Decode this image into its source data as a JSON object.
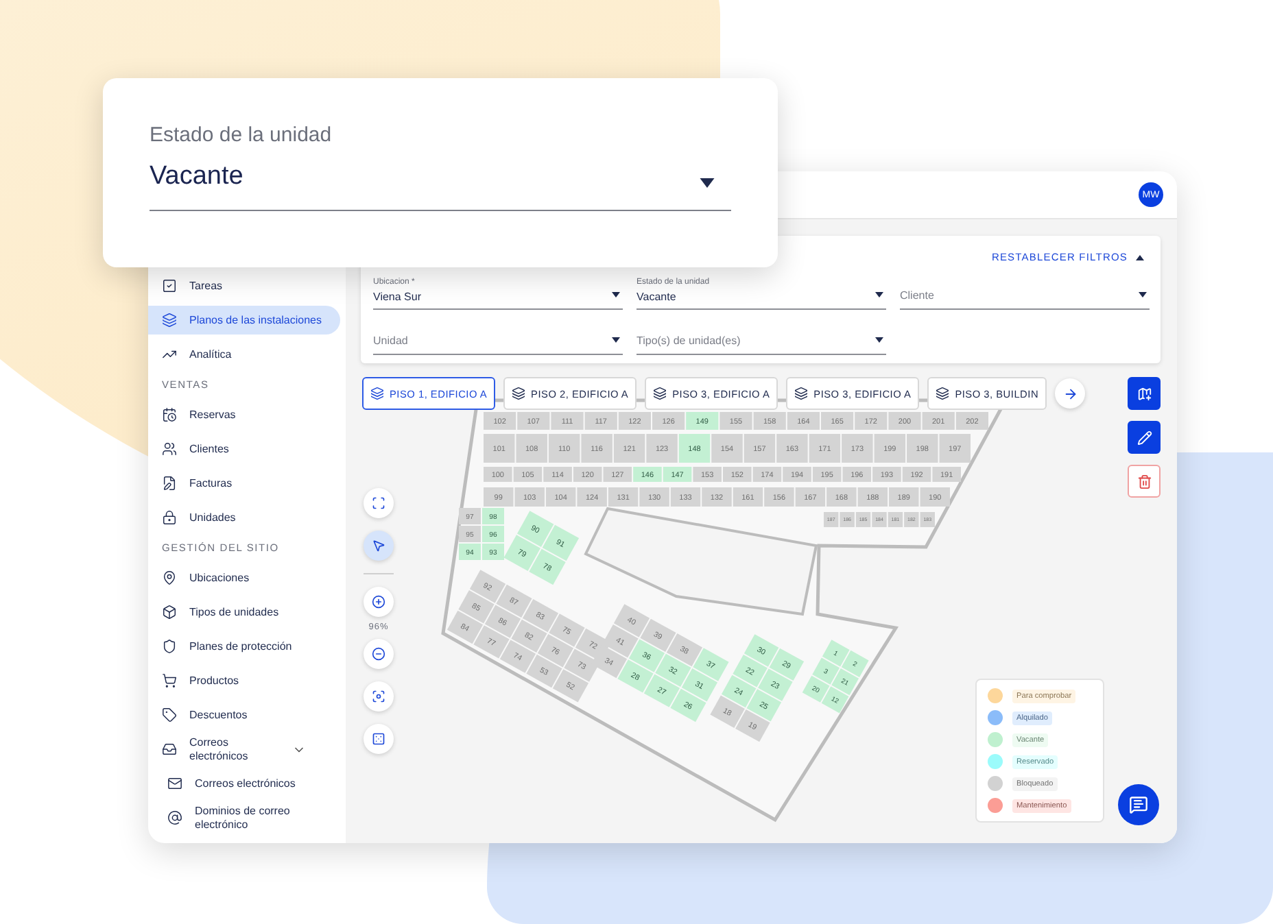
{
  "header": {
    "avatar": "MW"
  },
  "status_card": {
    "label": "Estado de la unidad",
    "value": "Vacante"
  },
  "sidebar": {
    "items": [
      {
        "kind": "item",
        "label": "Tareas",
        "selected": false
      },
      {
        "kind": "item",
        "label": "Planos de las instalaciones",
        "selected": true
      },
      {
        "kind": "item",
        "label": "Analítica",
        "selected": false
      },
      {
        "kind": "section",
        "label": "VENTAS"
      },
      {
        "kind": "item",
        "label": "Reservas",
        "selected": false
      },
      {
        "kind": "item",
        "label": "Clientes",
        "selected": false
      },
      {
        "kind": "item",
        "label": "Facturas",
        "selected": false
      },
      {
        "kind": "item",
        "label": "Unidades",
        "selected": false
      },
      {
        "kind": "section",
        "label": "GESTIÓN DEL SITIO"
      },
      {
        "kind": "item",
        "label": "Ubicaciones",
        "selected": false
      },
      {
        "kind": "item",
        "label": "Tipos de unidades",
        "selected": false
      },
      {
        "kind": "item",
        "label": "Planes de protección",
        "selected": false
      },
      {
        "kind": "item",
        "label": "Productos",
        "selected": false
      },
      {
        "kind": "item",
        "label": "Descuentos",
        "selected": false
      },
      {
        "kind": "item",
        "label": "Correos electrónicos",
        "selected": false,
        "expanded": true,
        "children": [
          {
            "label": "Correos electrónicos",
            "selected": false
          },
          {
            "label": "Dominios de correo electrónico",
            "selected": false
          }
        ]
      }
    ]
  },
  "filters": {
    "reset_label": "RESTABLECER FILTROS",
    "expanded": true,
    "fields": [
      {
        "label": "Ubicacion *",
        "value": "Viena Sur"
      },
      {
        "label": "Estado de la unidad",
        "value": "Vacante"
      },
      {
        "placeholder": "Cliente"
      },
      {
        "placeholder": "Unidad"
      },
      {
        "placeholder": "Tipo(s) de unidad(es)"
      }
    ]
  },
  "tabs": [
    {
      "label": "PISO 1, EDIFICIO A",
      "selected": true
    },
    {
      "label": "PISO 2, EDIFICIO A",
      "selected": false
    },
    {
      "label": "PISO 3, EDIFICIO A",
      "selected": false
    },
    {
      "label": "PISO 3, EDIFICIO A",
      "selected": false
    },
    {
      "label": "PISO 3, BUILDIN",
      "selected": false
    }
  ],
  "actions": [
    {
      "kind": "add_map"
    },
    {
      "kind": "edit"
    },
    {
      "kind": "delete"
    }
  ],
  "map_tools": {
    "zoom_readout": "96%",
    "tools": [
      {
        "kind": "fullscreen",
        "selected": false
      },
      {
        "kind": "select",
        "selected": true
      },
      {
        "kind": "zoom_in",
        "selected": false
      },
      {
        "kind": "zoom_out",
        "selected": false
      },
      {
        "kind": "focus",
        "selected": false
      },
      {
        "kind": "random",
        "selected": false
      }
    ]
  },
  "legend": [
    {
      "label": "Para comprobar",
      "color": "#fdd79b"
    },
    {
      "label": "Alquilado",
      "color": "#8bbcf9"
    },
    {
      "label": "Vacante",
      "color": "#bff0cf"
    },
    {
      "label": "Reservado",
      "color": "#9bfbfb"
    },
    {
      "label": "Bloqueado",
      "color": "#d2d2d2"
    },
    {
      "label": "Mantenimiento",
      "color": "#fb9d95"
    }
  ],
  "floor_plan": {
    "blocks": [
      {
        "units": [
          {
            "label": "102",
            "vacant": false
          },
          {
            "label": "107",
            "vacant": false
          },
          {
            "label": "111",
            "vacant": false
          },
          {
            "label": "117",
            "vacant": false
          },
          {
            "label": "122",
            "vacant": false
          },
          {
            "label": "126",
            "vacant": false
          },
          {
            "label": "149",
            "vacant": true
          },
          {
            "label": "155",
            "vacant": false
          },
          {
            "label": "158",
            "vacant": false
          },
          {
            "label": "164",
            "vacant": false
          },
          {
            "label": "165",
            "vacant": false
          },
          {
            "label": "172",
            "vacant": false
          },
          {
            "label": "200",
            "vacant": false
          },
          {
            "label": "201",
            "vacant": false
          },
          {
            "label": "202",
            "vacant": false
          }
        ]
      },
      {
        "units": [
          {
            "label": "101",
            "vacant": false
          },
          {
            "label": "108",
            "vacant": false
          },
          {
            "label": "110",
            "vacant": false
          },
          {
            "label": "116",
            "vacant": false
          },
          {
            "label": "121",
            "vacant": false
          },
          {
            "label": "123",
            "vacant": false
          },
          {
            "label": "148",
            "vacant": true
          },
          {
            "label": "154",
            "vacant": false
          },
          {
            "label": "157",
            "vacant": false
          },
          {
            "label": "163",
            "vacant": false
          },
          {
            "label": "171",
            "vacant": false
          },
          {
            "label": "173",
            "vacant": false
          },
          {
            "label": "199",
            "vacant": false
          },
          {
            "label": "198",
            "vacant": false
          },
          {
            "label": "197",
            "vacant": false
          }
        ]
      },
      {
        "units": [
          {
            "label": "100",
            "vacant": false
          },
          {
            "label": "105",
            "vacant": false
          },
          {
            "label": "114",
            "vacant": false
          },
          {
            "label": "120",
            "vacant": false
          },
          {
            "label": "127",
            "vacant": false
          },
          {
            "label": "146",
            "vacant": true
          },
          {
            "label": "147",
            "vacant": true
          },
          {
            "label": "153",
            "vacant": false
          },
          {
            "label": "152",
            "vacant": false
          },
          {
            "label": "174",
            "vacant": false
          },
          {
            "label": "194",
            "vacant": false
          },
          {
            "label": "195",
            "vacant": false
          },
          {
            "label": "196",
            "vacant": false
          },
          {
            "label": "193",
            "vacant": false
          },
          {
            "label": "192",
            "vacant": false
          },
          {
            "label": "191",
            "vacant": false
          }
        ]
      },
      {
        "units": [
          {
            "label": "99",
            "vacant": false
          },
          {
            "label": "103",
            "vacant": false
          },
          {
            "label": "104",
            "vacant": false
          },
          {
            "label": "124",
            "vacant": false
          },
          {
            "label": "131",
            "vacant": false
          },
          {
            "label": "130",
            "vacant": false
          },
          {
            "label": "133",
            "vacant": false
          },
          {
            "label": "132",
            "vacant": false
          },
          {
            "label": "161",
            "vacant": false
          },
          {
            "label": "156",
            "vacant": false
          },
          {
            "label": "167",
            "vacant": false
          },
          {
            "label": "168",
            "vacant": false
          },
          {
            "label": "188",
            "vacant": false
          },
          {
            "label": "189",
            "vacant": false
          },
          {
            "label": "190",
            "vacant": false
          }
        ]
      },
      {
        "units": [
          {
            "label": "97",
            "vacant": false
          },
          {
            "label": "98",
            "vacant": true
          },
          {
            "label": "95",
            "vacant": false
          },
          {
            "label": "96",
            "vacant": true
          },
          {
            "label": "94",
            "vacant": true
          },
          {
            "label": "93",
            "vacant": true
          }
        ]
      },
      {
        "units": [
          {
            "label": "187",
            "vacant": false
          },
          {
            "label": "186",
            "vacant": false
          },
          {
            "label": "185",
            "vacant": false
          },
          {
            "label": "184",
            "vacant": false
          },
          {
            "label": "181",
            "vacant": false
          },
          {
            "label": "182",
            "vacant": false
          },
          {
            "label": "183",
            "vacant": false
          }
        ]
      },
      {
        "units": [
          {
            "label": "90",
            "vacant": true
          },
          {
            "label": "91",
            "vacant": true
          },
          {
            "label": "79",
            "vacant": true
          },
          {
            "label": "78",
            "vacant": true
          }
        ]
      },
      {
        "units": [
          {
            "label": "92",
            "vacant": false
          },
          {
            "label": "87",
            "vacant": false
          },
          {
            "label": "83",
            "vacant": false
          },
          {
            "label": "75",
            "vacant": false
          },
          {
            "label": "72",
            "vacant": false
          },
          {
            "label": "85",
            "vacant": false
          },
          {
            "label": "86",
            "vacant": false
          },
          {
            "label": "82",
            "vacant": false
          },
          {
            "label": "76",
            "vacant": false
          },
          {
            "label": "73",
            "vacant": false
          },
          {
            "label": "84",
            "vacant": false
          },
          {
            "label": "77",
            "vacant": false
          },
          {
            "label": "74",
            "vacant": false
          },
          {
            "label": "53",
            "vacant": false
          },
          {
            "label": "52",
            "vacant": false
          }
        ]
      },
      {
        "units": [
          {
            "label": "40",
            "vacant": false
          },
          {
            "label": "39",
            "vacant": false
          },
          {
            "label": "38",
            "vacant": false
          },
          {
            "label": "37",
            "vacant": true
          },
          {
            "label": "41",
            "vacant": false
          },
          {
            "label": "36",
            "vacant": true
          },
          {
            "label": "32",
            "vacant": true
          },
          {
            "label": "31",
            "vacant": true
          },
          {
            "label": "34",
            "vacant": false
          },
          {
            "label": "28",
            "vacant": true
          },
          {
            "label": "27",
            "vacant": true
          },
          {
            "label": "26",
            "vacant": true
          }
        ]
      },
      {
        "units": [
          {
            "label": "30",
            "vacant": true
          },
          {
            "label": "29",
            "vacant": true
          },
          {
            "label": "22",
            "vacant": true
          },
          {
            "label": "23",
            "vacant": true
          },
          {
            "label": "24",
            "vacant": true
          },
          {
            "label": "25",
            "vacant": true
          },
          {
            "label": "18",
            "vacant": false
          },
          {
            "label": "19",
            "vacant": false
          }
        ]
      },
      {
        "units": [
          {
            "label": "1",
            "vacant": true
          },
          {
            "label": "2",
            "vacant": true
          },
          {
            "label": "3",
            "vacant": true
          },
          {
            "label": "21",
            "vacant": true
          },
          {
            "label": "20",
            "vacant": true
          },
          {
            "label": "12",
            "vacant": true
          }
        ]
      }
    ]
  }
}
